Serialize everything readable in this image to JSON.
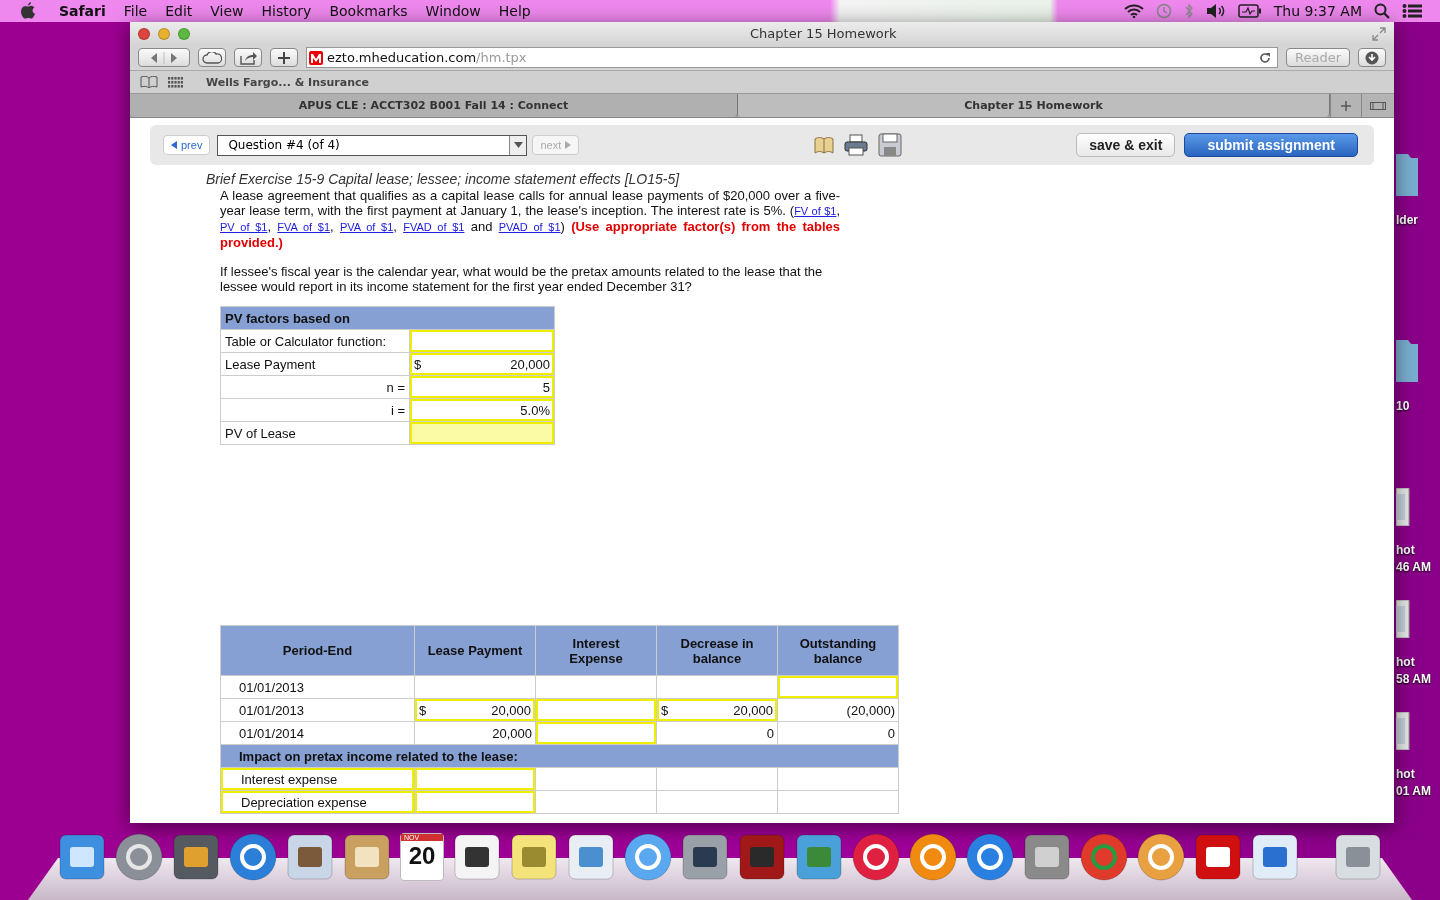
{
  "menubar": {
    "app": "Safari",
    "menus": [
      "File",
      "Edit",
      "View",
      "History",
      "Bookmarks",
      "Window",
      "Help"
    ],
    "clock": "Thu 9:37 AM"
  },
  "desktop_icons": [
    {
      "kind": "folder",
      "lines": [
        "lder"
      ]
    },
    {
      "kind": "folder",
      "lines": [
        "10"
      ]
    },
    {
      "kind": "screenshot",
      "lines": [
        "hot",
        "46 AM"
      ]
    },
    {
      "kind": "screenshot",
      "lines": [
        "hot",
        "58 AM"
      ]
    },
    {
      "kind": "screenshot",
      "lines": [
        "hot",
        "01 AM"
      ]
    }
  ],
  "window": {
    "title": "Chapter 15 Homework",
    "url_host": "ezto.mheducation.com",
    "url_path": "/hm.tpx",
    "reader": "Reader",
    "bookmarks": [
      "Wells Fargo... & Insurance"
    ],
    "tabs": [
      {
        "label": "APUS CLE : ACCT302 B001 Fall 14 : Connect",
        "selected": false
      },
      {
        "label": "Chapter 15 Homework",
        "selected": true
      }
    ]
  },
  "assignment_toolbar": {
    "prev": "prev",
    "question": "Question #4 (of 4)",
    "next": "next",
    "next_disabled": true,
    "save_exit": "save & exit",
    "submit": "submit assignment"
  },
  "problem": {
    "title": "Brief Exercise 15-9 Capital lease; lessee; income statement effects [LO15-5]",
    "text": "A lease agreement that qualifies as a capital lease calls for annual lease payments of $20,000 over a five-year lease term, with the first payment at January 1, the lease's inception. The interest rate is 5%. (",
    "links": [
      {
        "label": "FV of $1",
        "after": ", "
      },
      {
        "label": "PV of $1",
        "after": ", "
      },
      {
        "label": "FVA of $1",
        "after": ", "
      },
      {
        "label": "PVA of $1",
        "after": ", "
      },
      {
        "label": "FVAD of $1",
        "after": " and "
      },
      {
        "label": "PVAD of $1",
        "after": ") "
      }
    ],
    "instruction": "(Use appropriate factor(s) from the tables provided.)",
    "question": "If lessee's fiscal year is the calendar year, what would be the pretax amounts related to the lease that the lessee would report in its income statement for the first year ended December 31?"
  },
  "pv_table": {
    "title": "PV factors based on",
    "rows": [
      {
        "kind": "item",
        "label": "Table or Calculator function:",
        "highlighted": false
      },
      {
        "kind": "item",
        "label": "Lease Payment",
        "prefix": "$",
        "value": "20,000",
        "highlighted": false
      },
      {
        "kind": "variable",
        "label": "n =",
        "value": "5",
        "highlighted": false
      },
      {
        "kind": "variable",
        "label": "i =",
        "value": "5.0%",
        "highlighted": false
      },
      {
        "kind": "item",
        "label": "PV of Lease",
        "highlighted": true
      }
    ]
  },
  "schedule": {
    "columns": [
      "Period-End",
      "Lease Payment",
      "Interest Expense",
      "Decrease in balance",
      "Outstanding balance"
    ],
    "rows": [
      {
        "kind": "data",
        "cells": [
          {
            "kind": "label",
            "text": "01/01/2013"
          },
          {
            "kind": "empty"
          },
          {
            "kind": "empty"
          },
          {
            "kind": "empty"
          },
          {
            "kind": "input"
          }
        ]
      },
      {
        "kind": "data",
        "cells": [
          {
            "kind": "label",
            "text": "01/01/2013"
          },
          {
            "kind": "input",
            "prefix": "$",
            "text": "20,000"
          },
          {
            "kind": "input"
          },
          {
            "kind": "input",
            "prefix": "$",
            "text": "20,000"
          },
          {
            "kind": "value",
            "text": "(20,000)"
          }
        ]
      },
      {
        "kind": "data",
        "cells": [
          {
            "kind": "label",
            "text": "01/01/2014"
          },
          {
            "kind": "value",
            "text": "20,000"
          },
          {
            "kind": "input"
          },
          {
            "kind": "value",
            "text": "0"
          },
          {
            "kind": "value",
            "text": "0"
          }
        ]
      },
      {
        "kind": "section",
        "text": "Impact on pretax income related to the lease:"
      },
      {
        "kind": "data",
        "cells": [
          {
            "kind": "input",
            "text": "Interest expense"
          },
          {
            "kind": "input"
          },
          {
            "kind": "empty"
          },
          {
            "kind": "empty"
          },
          {
            "kind": "empty"
          }
        ]
      },
      {
        "kind": "data",
        "cells": [
          {
            "kind": "input",
            "text": "Depreciation expense"
          },
          {
            "kind": "input"
          },
          {
            "kind": "empty"
          },
          {
            "kind": "empty"
          },
          {
            "kind": "empty"
          }
        ]
      }
    ]
  },
  "dock": [
    {
      "kind": "finder"
    },
    {
      "kind": "launchpad"
    },
    {
      "kind": "media"
    },
    {
      "kind": "compass"
    },
    {
      "kind": "stamp"
    },
    {
      "kind": "book"
    },
    {
      "kind": "calendar",
      "month": "NOV",
      "day": "20"
    },
    {
      "kind": "checklist"
    },
    {
      "kind": "note"
    },
    {
      "kind": "preview"
    },
    {
      "kind": "bubble"
    },
    {
      "kind": "camera"
    },
    {
      "kind": "curtain"
    },
    {
      "kind": "photo"
    },
    {
      "kind": "music"
    },
    {
      "kind": "ibooks"
    },
    {
      "kind": "appstore"
    },
    {
      "kind": "gears"
    },
    {
      "kind": "chrome"
    },
    {
      "kind": "reader"
    },
    {
      "kind": "acrobat"
    },
    {
      "kind": "word"
    },
    {
      "kind": "trash"
    }
  ]
}
